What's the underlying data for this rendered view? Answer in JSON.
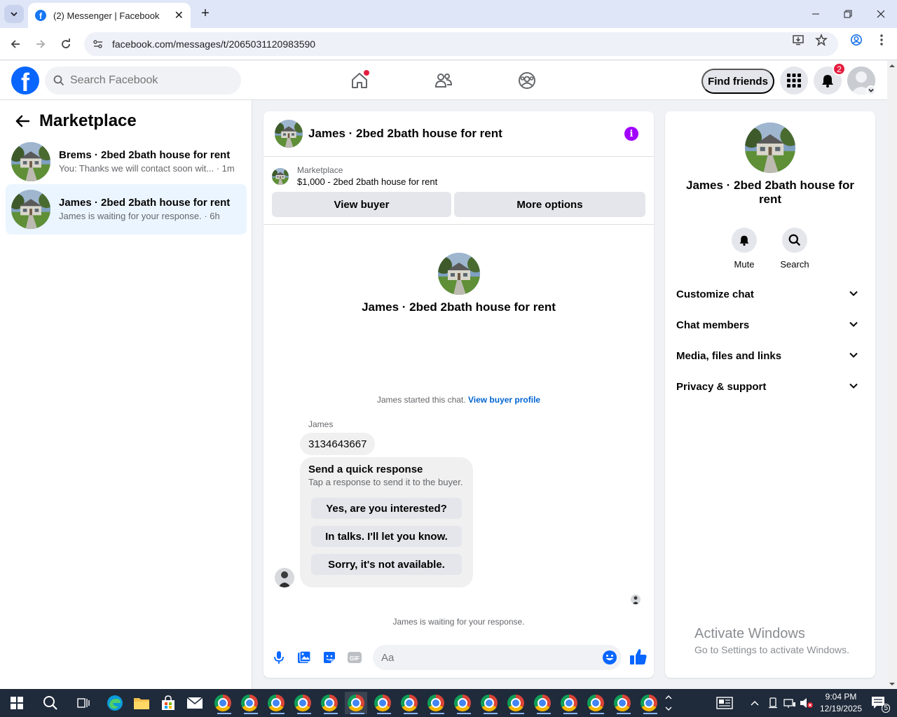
{
  "browser": {
    "tab_title": "(2) Messenger | Facebook",
    "url": "facebook.com/messages/t/2065031120983590"
  },
  "fb": {
    "search_placeholder": "Search Facebook",
    "find_friends": "Find friends",
    "notification_count": "2"
  },
  "sidebar": {
    "title": "Marketplace",
    "conversations": [
      {
        "name": "Brems · 2bed 2bath house for rent",
        "preview": "You: Thanks we will contact soon wit... · 1m",
        "active": false
      },
      {
        "name": "James · 2bed 2bath house for rent",
        "preview": "James is waiting for your response. · 6h",
        "active": true
      }
    ]
  },
  "chat": {
    "title": "James · 2bed 2bath house for rent",
    "listing_label": "Marketplace",
    "listing_price": "$1,000 - 2bed 2bath house for rent",
    "view_buyer": "View buyer",
    "more_options": "More options",
    "intro_name": "James · 2bed 2bath house for rent",
    "started_text": "James started this chat.",
    "view_buyer_profile": "View buyer profile",
    "sender": "James",
    "message": "3134643667",
    "quick_title": "Send a quick response",
    "quick_subtitle": "Tap a response to send it to the buyer.",
    "quick_replies": [
      "Yes, are you interested?",
      "In talks. I'll let you know.",
      "Sorry, it's not available."
    ],
    "waiting": "James is waiting for your response.",
    "composer_placeholder": "Aa"
  },
  "right_panel": {
    "name": "James · 2bed 2bath house for rent",
    "mute": "Mute",
    "search": "Search",
    "sections": [
      "Customize chat",
      "Chat members",
      "Media, files and links",
      "Privacy & support"
    ]
  },
  "watermark": {
    "line1": "Activate Windows",
    "line2": "Go to Settings to activate Windows."
  },
  "taskbar": {
    "time": "9:04 PM",
    "date": "12/19/2025",
    "notifications": "5"
  },
  "colors": {
    "fb_blue": "#0866ff",
    "info_purple": "#a100ff",
    "active_conversation": "#ebf5ff",
    "notification_red": "#e41e3f"
  }
}
